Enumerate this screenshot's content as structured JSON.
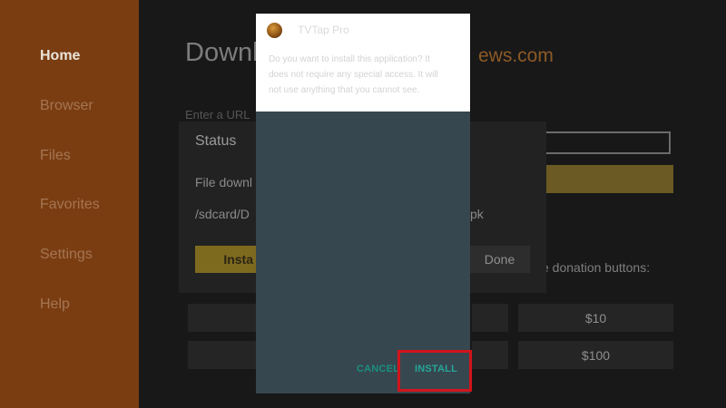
{
  "sidebar": {
    "items": [
      {
        "label": "Home",
        "active": true
      },
      {
        "label": "Browser",
        "active": false
      },
      {
        "label": "Files",
        "active": false
      },
      {
        "label": "Favorites",
        "active": false
      },
      {
        "label": "Settings",
        "active": false
      },
      {
        "label": "Help",
        "active": false
      }
    ]
  },
  "main": {
    "title": "Downl",
    "site": "ews.com",
    "url_label": "Enter a URL",
    "donation_note": "e donation buttons:",
    "donations": [
      "$10",
      "$100"
    ]
  },
  "status_dialog": {
    "title": "Status",
    "line1": "File downl",
    "line2": "/sdcard/D",
    "line2_suffix": "pk",
    "install_label": "Insta",
    "done_label": "Done"
  },
  "installer": {
    "app_name": "TVTap Pro",
    "description_lines": [
      "Do you want to install this application? It",
      "does not require any special access. It will",
      "not use anything that you cannot see."
    ],
    "cancel_label": "CANCEL",
    "install_label": "INSTALL"
  },
  "colors": {
    "sidebar": "#7a3d12",
    "installer_body": "#37474f",
    "accent_teal": "#26a69a",
    "highlight_red": "#d2141c"
  }
}
